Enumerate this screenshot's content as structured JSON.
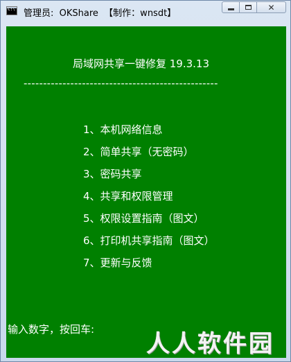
{
  "window": {
    "title": "管理员:  OKShare  【制作：wnsdt】",
    "icon": "console-icon",
    "icon_text": "C:\\"
  },
  "console": {
    "heading": "局域网共享一键修复 19.3.13",
    "divider": "--------------------------------------------------",
    "menu": [
      "1、本机网络信息",
      "2、简单共享（无密码）",
      "3、密码共享",
      "4、共享和权限管理",
      "5、权限设置指南（图文）",
      "6、打印机共享指南（图文）",
      "7、更新与反馈"
    ],
    "prompt": "输入数字，按回车:",
    "background_color": "#008000",
    "text_color": "#ffffff"
  },
  "watermark": "人人软件园"
}
